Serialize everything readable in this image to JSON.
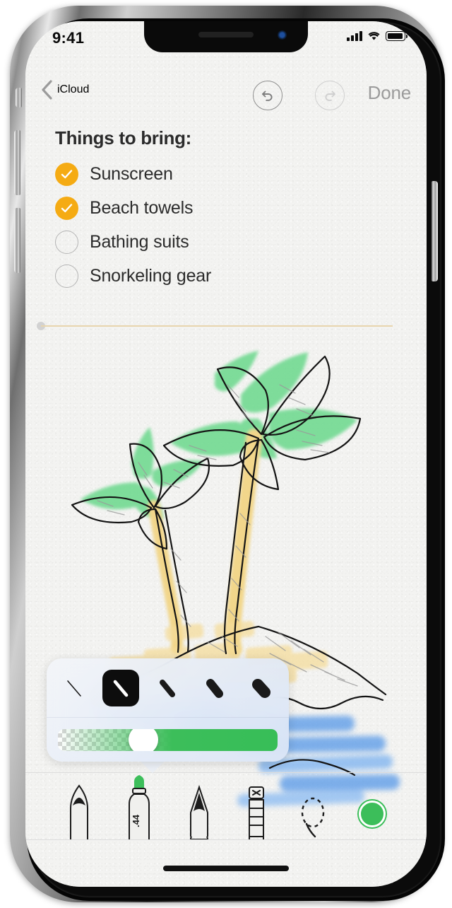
{
  "status_bar": {
    "time": "9:41",
    "cellular_icon": "signal-bars-icon",
    "wifi_icon": "wifi-icon",
    "battery_icon": "battery-icon",
    "battery_level_pct": 92
  },
  "nav_bar": {
    "back_label": "iCloud",
    "back_icon": "chevron-left-icon",
    "undo_icon": "undo-icon",
    "undo_enabled": true,
    "redo_icon": "redo-icon",
    "redo_enabled": false,
    "done_label": "Done"
  },
  "note": {
    "title": "Things to bring:",
    "checklist": [
      {
        "label": "Sunscreen",
        "checked": true
      },
      {
        "label": "Beach towels",
        "checked": true
      },
      {
        "label": "Bathing suits",
        "checked": false
      },
      {
        "label": "Snorkeling gear",
        "checked": false
      }
    ],
    "checked_color": "#F5AB13",
    "divider_color": "#E8D5AE"
  },
  "drawing": {
    "description": "Hand-drawn sketch of two palm trees on a sandy island with ocean waves",
    "leaf_color": "#6BD88C",
    "trunk_color": "#F2D27A",
    "sand_color": "#F5DC99",
    "water_color": "#5B9BE8",
    "ink_color": "#141414"
  },
  "width_popover": {
    "options": [
      {
        "name": "width-1-hairline",
        "selected": false,
        "thickness": 2
      },
      {
        "name": "width-2-thin",
        "selected": true,
        "thickness": 8
      },
      {
        "name": "width-3-medium",
        "selected": false,
        "thickness": 11
      },
      {
        "name": "width-4-thick",
        "selected": false,
        "thickness": 15
      },
      {
        "name": "width-5-thickest",
        "selected": false,
        "thickness": 19
      }
    ],
    "opacity_slider": {
      "name": "opacity-slider",
      "value_pct": 39,
      "color": "#3CBE5A"
    }
  },
  "tool_bar": {
    "tools": [
      {
        "name": "pen-tool",
        "label": "Pen",
        "selected": false
      },
      {
        "name": "marker-tool",
        "label": "Marker",
        "selected": true,
        "badge": ".44"
      },
      {
        "name": "pencil-tool",
        "label": "Pencil",
        "selected": false
      },
      {
        "name": "eraser-tool",
        "label": "Eraser",
        "selected": false
      },
      {
        "name": "lasso-tool",
        "label": "Lasso",
        "selected": false
      },
      {
        "name": "color-swatch",
        "label": "Color",
        "selected": false,
        "color": "#3CBE5A"
      }
    ]
  }
}
